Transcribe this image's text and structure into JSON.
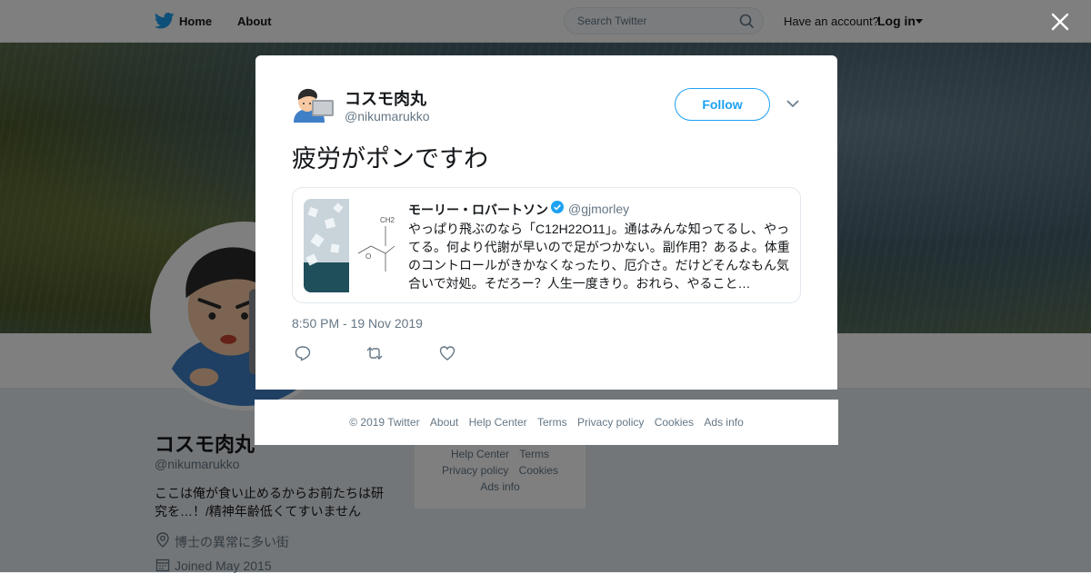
{
  "topnav": {
    "home": "Home",
    "about": "About",
    "search_placeholder": "Search Twitter",
    "have_account": "Have an account?",
    "login": "Log in"
  },
  "profile": {
    "name": "コスモ肉丸",
    "handle": "@nikumarukko",
    "bio": "ここは俺が食い止めるからお前たちは研究を…！/精神年齢低くてすいません",
    "location": "博士の異常に多い街",
    "joined": "Joined May 2015"
  },
  "side_links": {
    "help_center": "Help Center",
    "terms": "Terms",
    "privacy": "Privacy policy",
    "cookies": "Cookies",
    "ads_info": "Ads info"
  },
  "tweet": {
    "author_name": "コスモ肉丸",
    "author_handle": "@nikumarukko",
    "follow_label": "Follow",
    "text": "疲労がポンですわ",
    "timestamp": "8:50 PM - 19 Nov 2019",
    "quote": {
      "name": "モーリー・ロバートソン",
      "handle": "@gjmorley",
      "text": "やっぱり飛ぶのなら「C12H22O11」。通はみんな知ってるし、やってる。何より代謝が早いので足がつかない。副作用？あるよ。体重のコントロールがきかなくなったり、厄介さ。だけどそんなもん気合いで対処。そだろー？人生一度きり。おれら、やること…",
      "media_text": "CH2"
    }
  },
  "footer": {
    "copyright": "© 2019 Twitter",
    "about": "About",
    "help_center": "Help Center",
    "terms": "Terms",
    "privacy": "Privacy policy",
    "cookies": "Cookies",
    "ads_info": "Ads info"
  },
  "colors": {
    "brand": "#1da1f2",
    "text": "#14171a",
    "muted": "#657786"
  }
}
